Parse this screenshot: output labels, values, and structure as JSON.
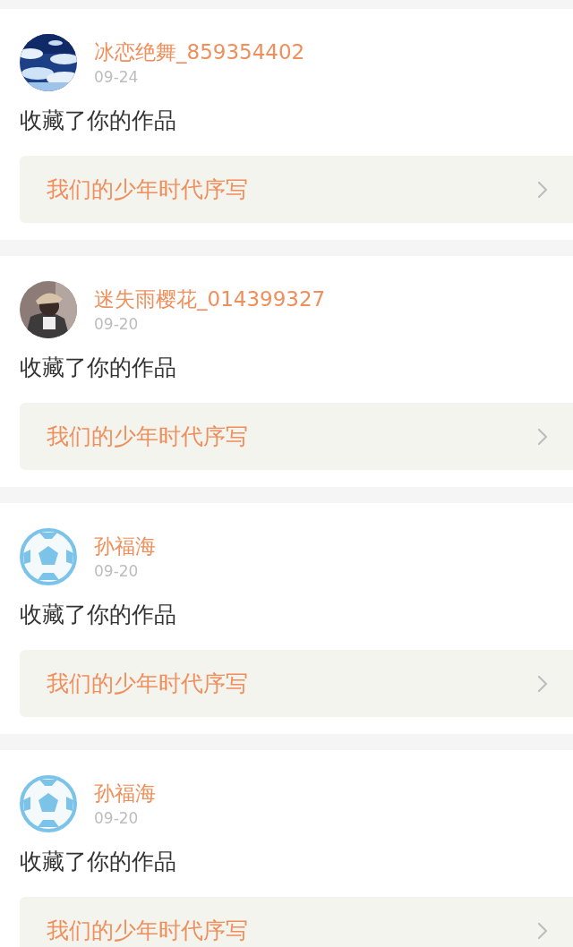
{
  "notifications": [
    {
      "user": "冰恋绝舞_859354402",
      "date": "09-24",
      "action": "收藏了你的作品",
      "work": "我们的少年时代序写"
    },
    {
      "user": "迷失雨樱花_014399327",
      "date": "09-20",
      "action": "收藏了你的作品",
      "work": "我们的少年时代序写"
    },
    {
      "user": "孙福海",
      "date": "09-20",
      "avatar": {
        "kind": "ball"
      },
      "action": "收藏了你的作品",
      "work": "我们的少年时代序写"
    },
    {
      "user": "孙福海",
      "date": "09-20",
      "avatar": {
        "kind": "ball"
      },
      "action": "收藏了你的作品",
      "work": "我们的少年时代序写"
    }
  ]
}
